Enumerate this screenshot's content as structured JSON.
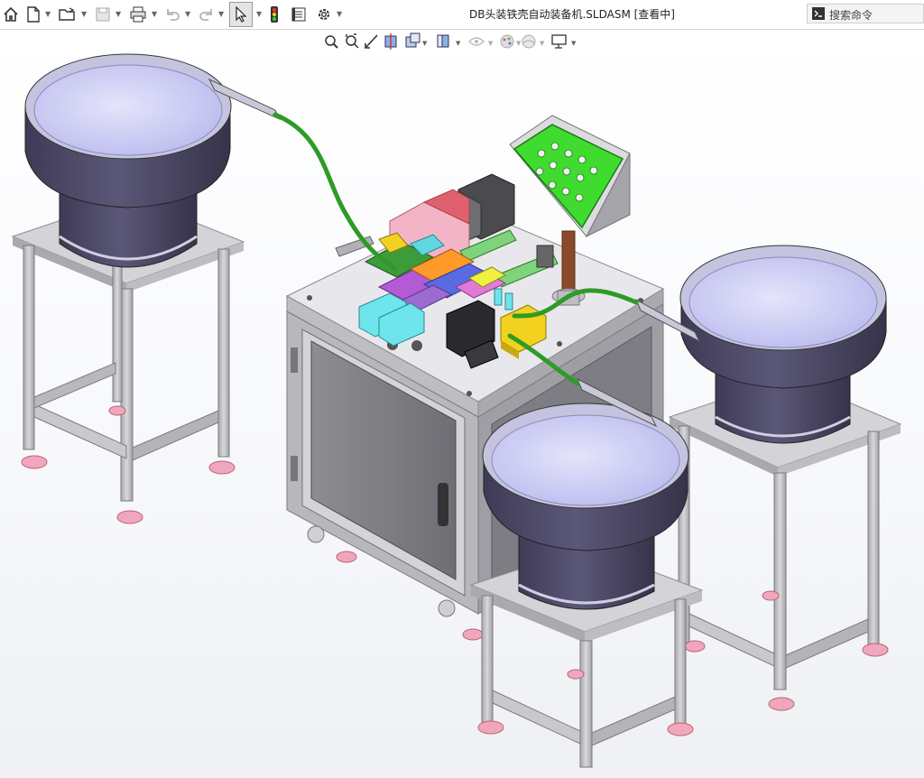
{
  "window": {
    "title": "DB头装铁壳自动装备机.SLDASM [查看中]"
  },
  "toolbar": {
    "items": [
      "home-icon",
      "new-document-icon",
      "open-folder-icon",
      "save-icon",
      "print-icon",
      "undo-icon",
      "redo-icon",
      "select-cursor-icon",
      "traffic-light-icon",
      "file-properties-icon",
      "gear-icon"
    ]
  },
  "search": {
    "placeholder": "搜索命令"
  },
  "view_toolbar": {
    "items": [
      "zoom-to-fit-icon",
      "zoom-area-icon",
      "previous-view-icon",
      "section-view-icon",
      "view-orientation-icon",
      "display-style-icon",
      "hide-show-icon",
      "edit-appearance-icon",
      "apply-scene-icon",
      "view-settings-icon"
    ]
  },
  "colors": {
    "bowl_body": "#4e4a66",
    "bowl_inner": "#cfd0f5",
    "frame": "#c9c9cd",
    "feet": "#f1a6c0",
    "tube": "#2f9b27",
    "accent_yellow": "#f2d21e",
    "accent_cyan": "#5fd6e0",
    "accent_magenta": "#b45ad6"
  }
}
